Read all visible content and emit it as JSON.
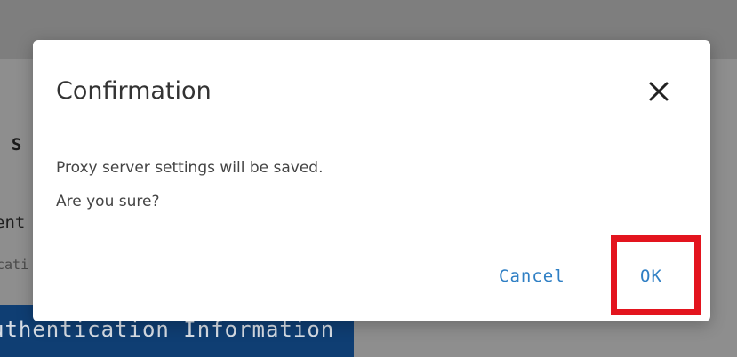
{
  "background": {
    "section_fragment": "n S",
    "field_fragment": "ent",
    "hint_fragment": "cati",
    "button_fragment": "uthentication Information"
  },
  "dialog": {
    "title": "Confirmation",
    "close_icon": "close-icon",
    "message_line1": "Proxy server settings will be saved.",
    "message_line2": "Are you sure?",
    "cancel_label": "Cancel",
    "ok_label": "OK"
  },
  "colors": {
    "link_blue": "#2f7fc4",
    "highlight_red": "#e3141e",
    "background_button": "#0f3e73"
  }
}
